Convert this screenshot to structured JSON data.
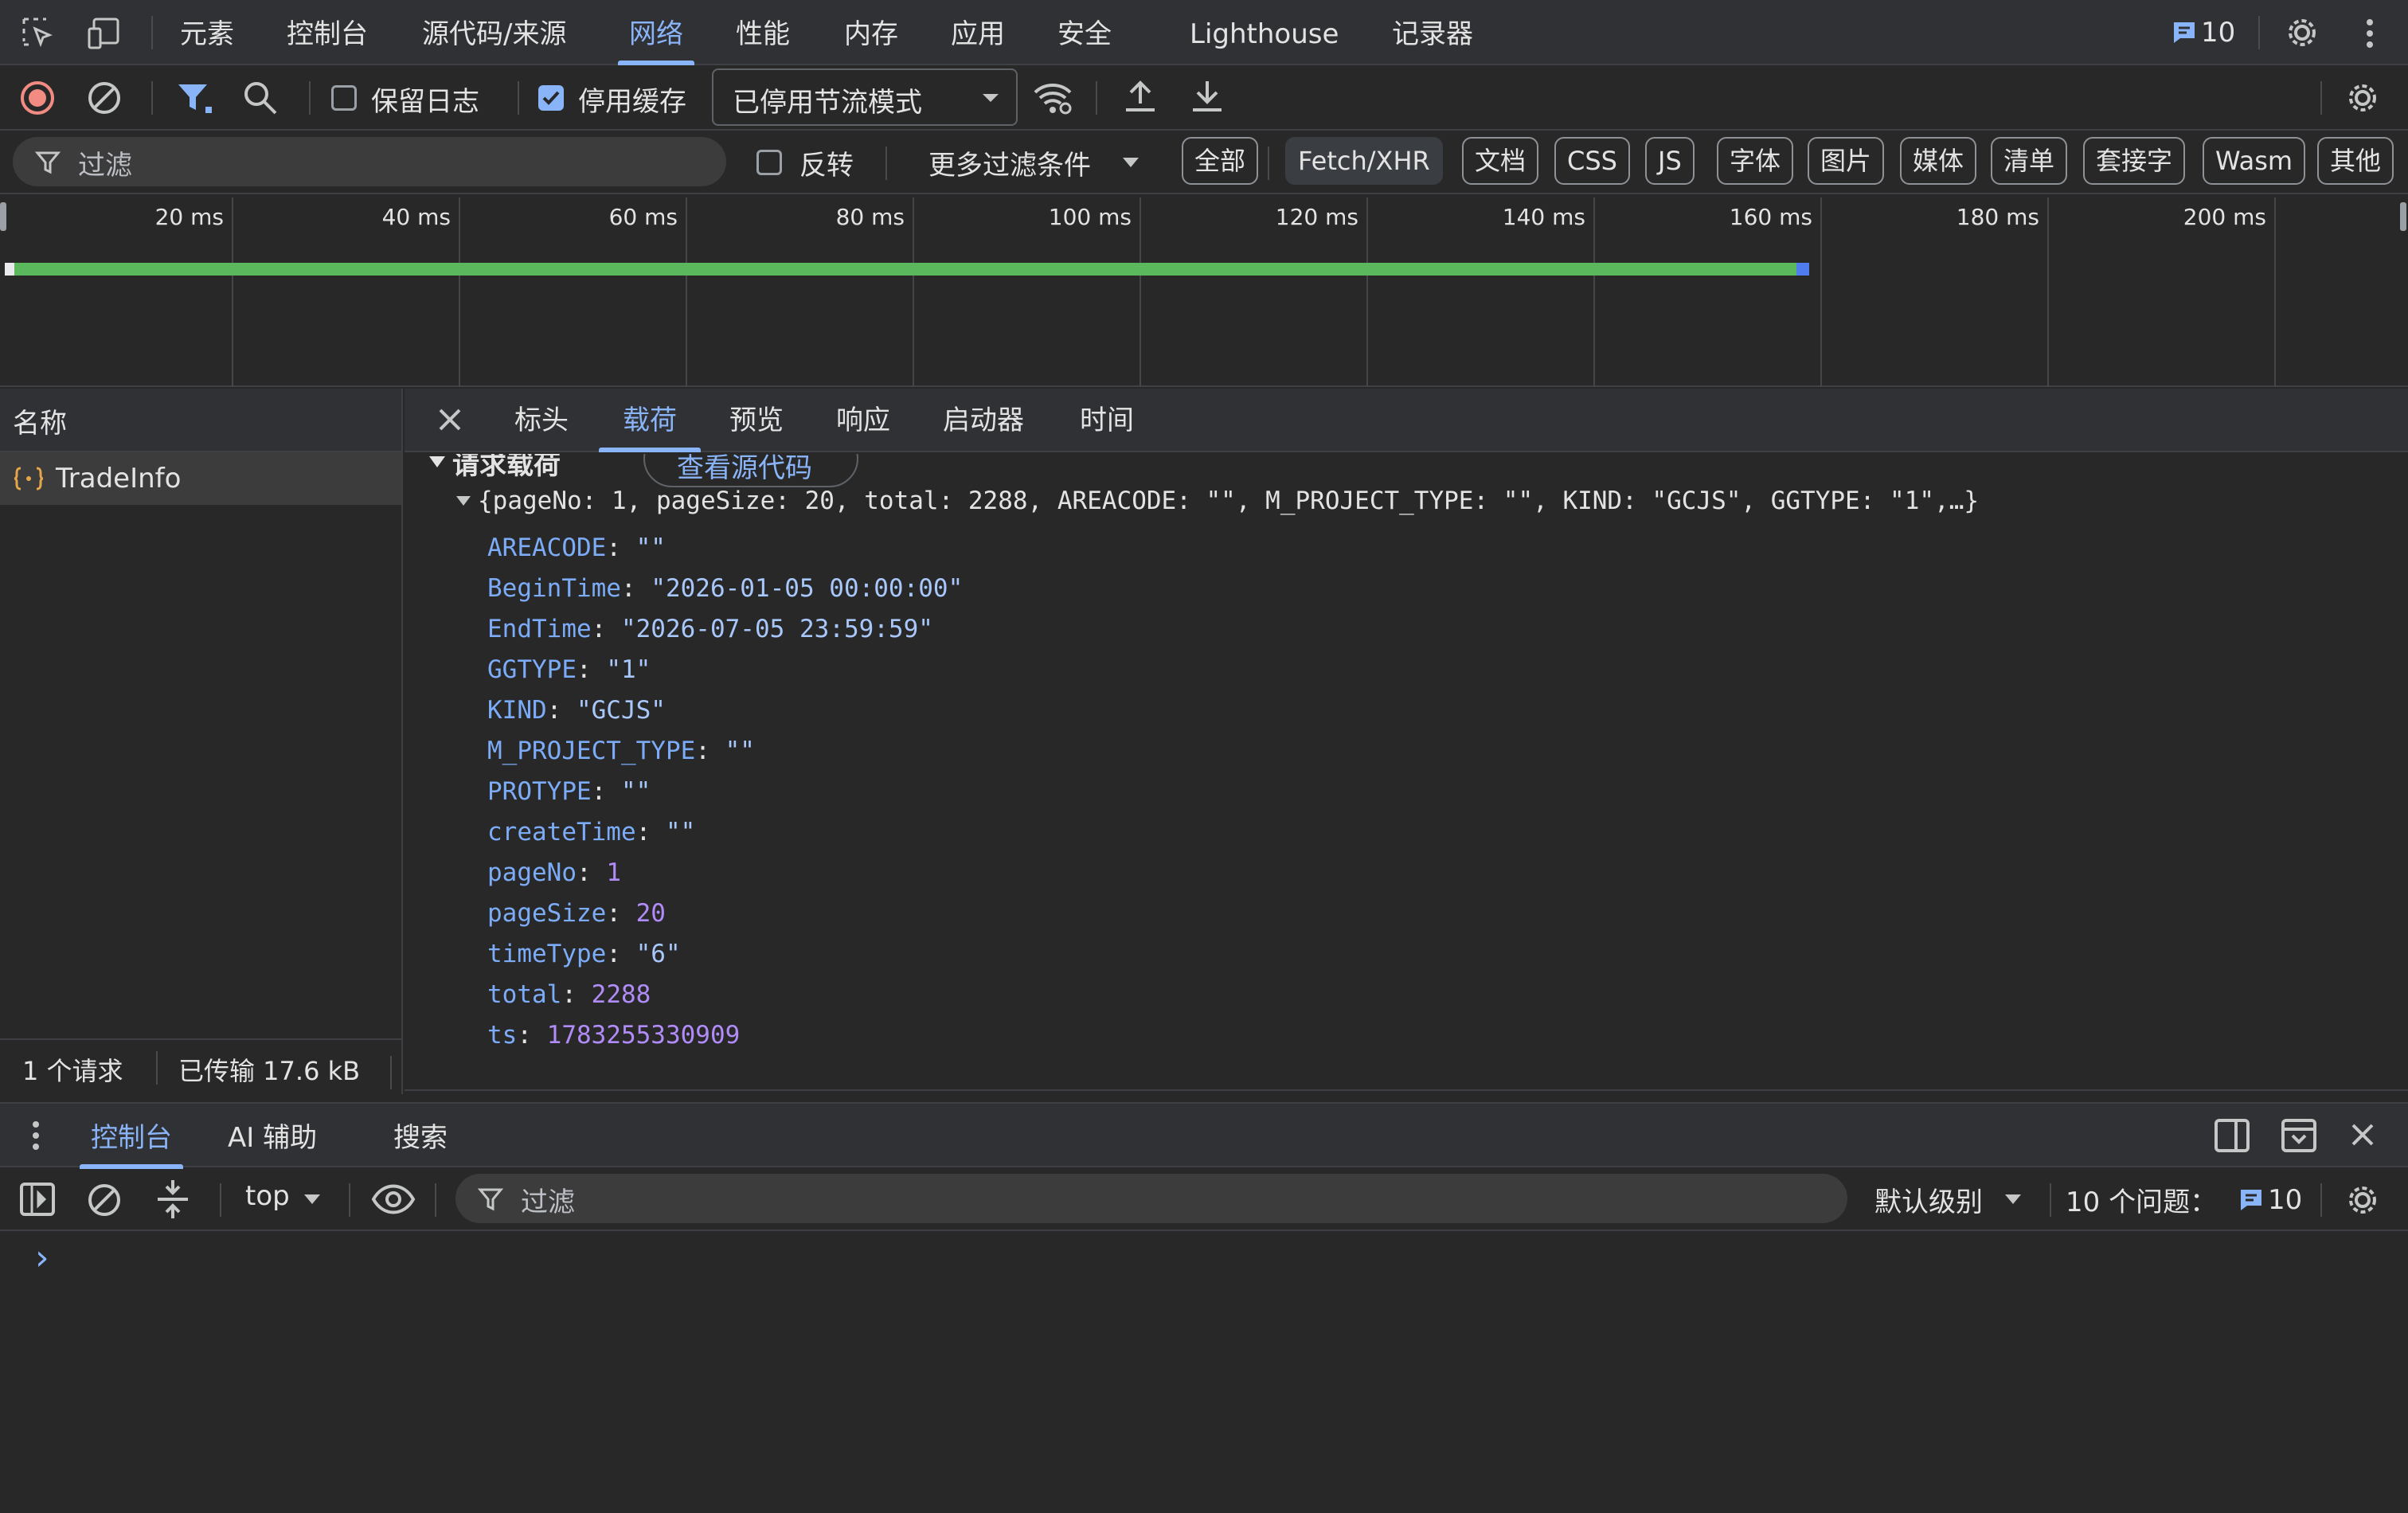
{
  "main_tabs": [
    {
      "label": "元素"
    },
    {
      "label": "控制台"
    },
    {
      "label": "源代码/来源"
    },
    {
      "label": "网络"
    },
    {
      "label": "性能"
    },
    {
      "label": "内存"
    },
    {
      "label": "应用"
    },
    {
      "label": "安全"
    },
    {
      "label": "Lighthouse"
    },
    {
      "label": "记录器"
    }
  ],
  "active_main_tab": "网络",
  "issues_count": "10",
  "toolbar": {
    "preserve_log": {
      "label": "保留日志",
      "checked": false
    },
    "disable_cache": {
      "label": "停用缓存",
      "checked": true
    },
    "throttle_select": "已停用节流模式"
  },
  "filter": {
    "placeholder": "过滤",
    "invert_label": "反转",
    "more_filters": "更多过滤条件",
    "types": [
      "全部",
      "Fetch/XHR",
      "文档",
      "CSS",
      "JS",
      "字体",
      "图片",
      "媒体",
      "清单",
      "套接字",
      "Wasm",
      "其他"
    ],
    "active_type": "Fetch/XHR"
  },
  "timeline": {
    "ticks": [
      "20 ms",
      "40 ms",
      "60 ms",
      "80 ms",
      "100 ms",
      "120 ms",
      "140 ms",
      "160 ms",
      "180 ms",
      "200 ms"
    ],
    "bar_end_ms": 159,
    "colors": {
      "waiting": "#5cb85c",
      "download": "#4f7df0"
    }
  },
  "requests": {
    "column_header": "名称",
    "items": [
      {
        "name": "TradeInfo"
      }
    ]
  },
  "detail_tabs": [
    "标头",
    "载荷",
    "预览",
    "响应",
    "启动器",
    "时间"
  ],
  "active_detail_tab": "载荷",
  "payload": {
    "section_title": "请求载荷",
    "view_source": "查看源代码",
    "summary": "{pageNo: 1, pageSize: 20, total: 2288, AREACODE: \"\", M_PROJECT_TYPE: \"\", KIND: \"GCJS\", GGTYPE: \"1\",…}",
    "fields": [
      {
        "key": "AREACODE",
        "value": "\"\"",
        "type": "string"
      },
      {
        "key": "BeginTime",
        "value": "\"2026-01-05 00:00:00\"",
        "type": "string"
      },
      {
        "key": "EndTime",
        "value": "\"2026-07-05 23:59:59\"",
        "type": "string"
      },
      {
        "key": "GGTYPE",
        "value": "\"1\"",
        "type": "string"
      },
      {
        "key": "KIND",
        "value": "\"GCJS\"",
        "type": "string"
      },
      {
        "key": "M_PROJECT_TYPE",
        "value": "\"\"",
        "type": "string"
      },
      {
        "key": "PROTYPE",
        "value": "\"\"",
        "type": "string"
      },
      {
        "key": "createTime",
        "value": "\"\"",
        "type": "string"
      },
      {
        "key": "pageNo",
        "value": "1",
        "type": "number"
      },
      {
        "key": "pageSize",
        "value": "20",
        "type": "number"
      },
      {
        "key": "timeType",
        "value": "\"6\"",
        "type": "string"
      },
      {
        "key": "total",
        "value": "2288",
        "type": "number"
      },
      {
        "key": "ts",
        "value": "1783255330909",
        "type": "number"
      }
    ]
  },
  "status_bar": {
    "requests": "1 个请求",
    "transferred": "已传输 17.6 kB"
  },
  "drawer": {
    "tabs": [
      "控制台",
      "AI 辅助",
      "搜索"
    ],
    "active_tab": "控制台",
    "context": "top",
    "filter_placeholder": "过滤",
    "level": "默认级别",
    "issues_label": "10 个问题：",
    "issues_count": "10",
    "prompt": "›"
  },
  "colors": {
    "accent": "#8ab4f8",
    "record": "#f28b82",
    "background": "#282828"
  }
}
